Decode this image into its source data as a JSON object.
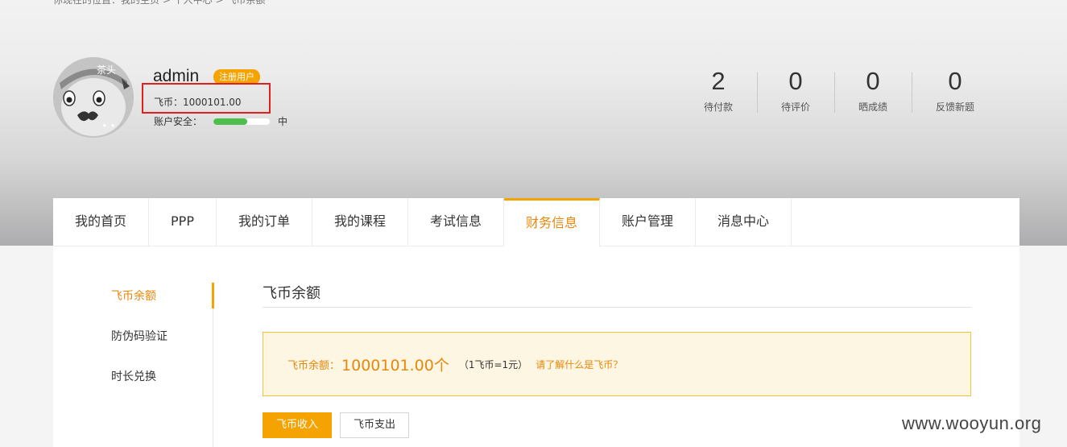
{
  "breadcrumb": "你现在的位置：我的主页 > 个人中心 > 飞币余额",
  "user": {
    "name": "admin",
    "badge": "注册用户",
    "coin_label": "飞币：",
    "coin_value": "1000101.00",
    "security_label": "账户安全：",
    "security_level": "中",
    "security_fill": 0.6
  },
  "stats": [
    {
      "value": "2",
      "label": "待付款"
    },
    {
      "value": "0",
      "label": "待评价"
    },
    {
      "value": "0",
      "label": "晒成绩"
    },
    {
      "value": "0",
      "label": "反馈新题"
    }
  ],
  "tabs": [
    {
      "label": "我的首页"
    },
    {
      "label": "PPP"
    },
    {
      "label": "我的订单"
    },
    {
      "label": "我的课程"
    },
    {
      "label": "考试信息"
    },
    {
      "label": "财务信息",
      "active": true
    },
    {
      "label": "账户管理"
    },
    {
      "label": "消息中心"
    }
  ],
  "side_nav": [
    {
      "label": "飞币余额",
      "active": true
    },
    {
      "label": "防伪码验证"
    },
    {
      "label": "时长兑换"
    }
  ],
  "section_title": "飞币余额",
  "balance": {
    "label": "飞币余额：",
    "value": "1000101.00个",
    "rate": "（1飞币=1元）",
    "link": "请了解什么是飞币？"
  },
  "buttons": {
    "income": "飞币收入",
    "expense": "飞币支出"
  },
  "watermark": "www.wooyun.org",
  "colors": {
    "accent": "#f5a300",
    "accent_text": "#e8870c",
    "highlight_border": "#e02020",
    "security_fill": "#4cbf4c"
  }
}
